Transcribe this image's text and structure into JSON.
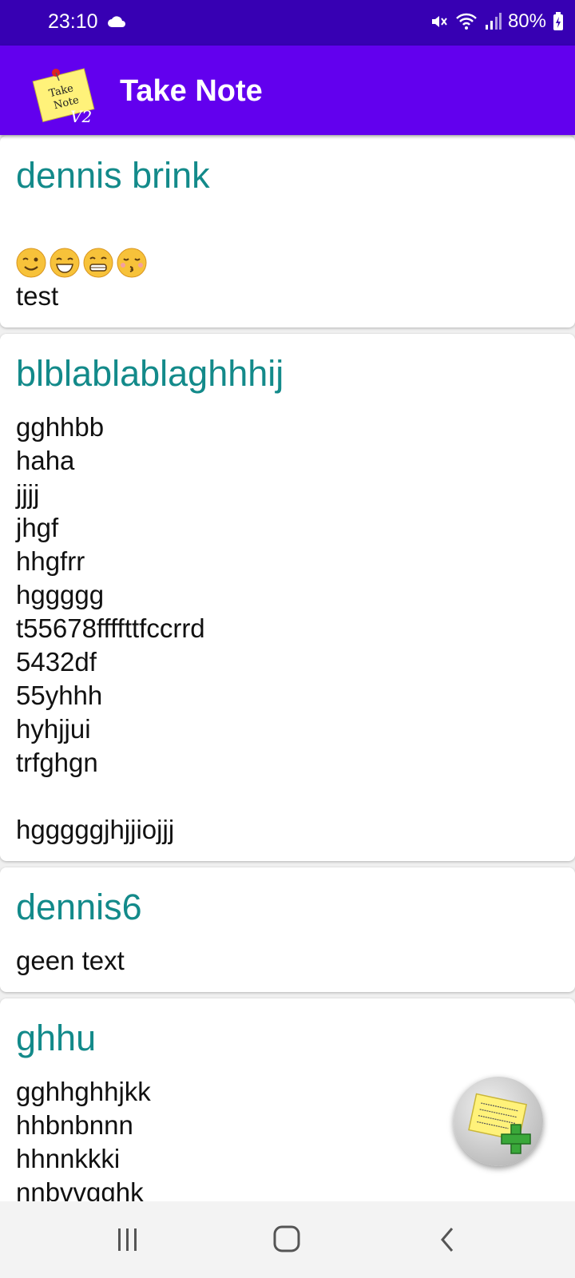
{
  "status": {
    "time": "23:10",
    "battery": "80%"
  },
  "app": {
    "title": "Take Note",
    "logo_text_line1": "Take",
    "logo_text_line2": "Note",
    "logo_version": "V2"
  },
  "notes": [
    {
      "title": "dennis brink",
      "body": "test",
      "emojis": [
        "wink-emoji",
        "laughing-emoji",
        "grin-emoji",
        "kissing-emoji"
      ]
    },
    {
      "title": "blblablablaghhhij",
      "body": "gghhbb\nhaha\njjjj\njhgf\nhhgfrr\nhggggg\nt55678ffffttfccrrd\n5432df\n55yhhh\nhyhjjui\ntrfghgn\n\nhgggggjhjjiojjj"
    },
    {
      "title": "dennis6",
      "body": "geen text"
    },
    {
      "title": "ghhu",
      "body": "gghhghhjkk\nhhbnbnnn\nhhnnkkki\nnnbvvgghk"
    }
  ],
  "colors": {
    "status_bar": "#3700b3",
    "app_bar": "#6200ee",
    "note_title": "#138a8a"
  },
  "icons": {
    "fab": "add-note-icon",
    "nav_recents": "recents-icon",
    "nav_home": "home-icon",
    "nav_back": "back-icon"
  }
}
